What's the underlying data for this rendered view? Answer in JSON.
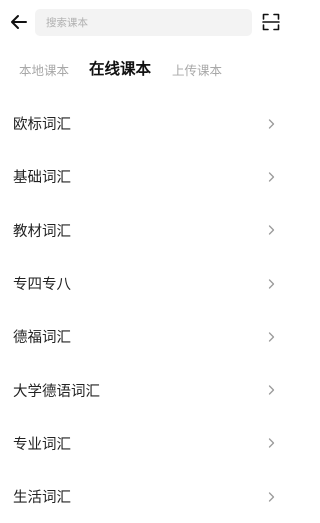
{
  "header": {
    "search_placeholder": "搜索课本",
    "back_icon": "arrow-left-icon",
    "scan_icon": "scan-frame-icon"
  },
  "tabs": [
    {
      "label": "本地课本",
      "active": false
    },
    {
      "label": "在线课本",
      "active": true
    },
    {
      "label": "上传课本",
      "active": false
    }
  ],
  "categories": [
    {
      "label": "欧标词汇"
    },
    {
      "label": "基础词汇"
    },
    {
      "label": "教材词汇"
    },
    {
      "label": "专四专八"
    },
    {
      "label": "德福词汇"
    },
    {
      "label": "大学德语词汇"
    },
    {
      "label": "专业词汇"
    },
    {
      "label": "生活词汇"
    }
  ],
  "colors": {
    "text_primary": "#222222",
    "text_inactive": "#a8a8a8",
    "search_bg": "#f3f3f3",
    "chevron": "#9a9a9a"
  }
}
